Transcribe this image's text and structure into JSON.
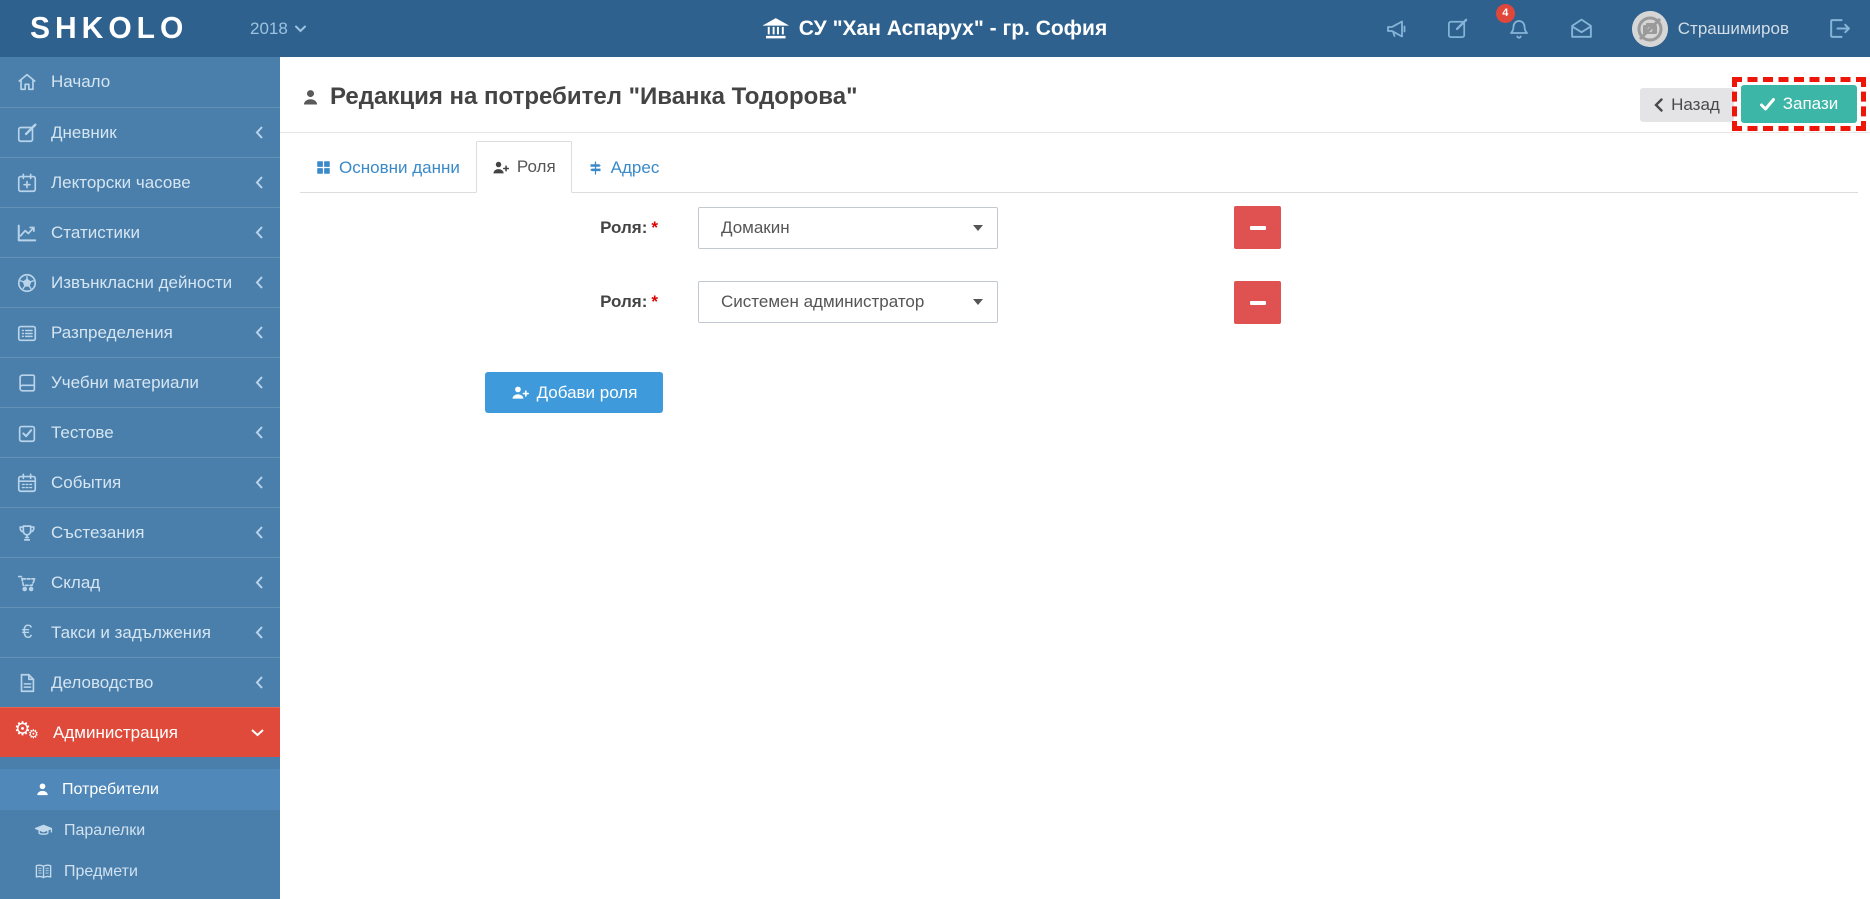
{
  "header": {
    "logo": "SHKOLO",
    "year": "2018",
    "school_name": "СУ \"Хан Аспарух\" - гр. София",
    "notifications_badge": "4",
    "username": "Страшимиров"
  },
  "sidebar": {
    "items": [
      {
        "label": "Начало",
        "icon": "home-icon",
        "expandable": false
      },
      {
        "label": "Дневник",
        "icon": "journal-icon",
        "expandable": true
      },
      {
        "label": "Лекторски часове",
        "icon": "calendar-plus-icon",
        "expandable": true
      },
      {
        "label": "Статистики",
        "icon": "line-chart-icon",
        "expandable": true
      },
      {
        "label": "Извънкласни дейности",
        "icon": "soccer-ball-icon",
        "expandable": true
      },
      {
        "label": "Разпределения",
        "icon": "list-icon",
        "expandable": true
      },
      {
        "label": "Учебни материали",
        "icon": "book-icon",
        "expandable": true
      },
      {
        "label": "Тестове",
        "icon": "check-square-icon",
        "expandable": true
      },
      {
        "label": "События",
        "icon": "calendar-icon",
        "expandable": true
      },
      {
        "label": "Състезания",
        "icon": "trophy-icon",
        "expandable": true
      },
      {
        "label": "Склад",
        "icon": "cart-icon",
        "expandable": true
      },
      {
        "label": "Такси и задължения",
        "icon": "euro-icon",
        "expandable": true
      },
      {
        "label": "Деловодство",
        "icon": "file-text-icon",
        "expandable": true
      },
      {
        "label": "Администрация",
        "icon": "gears-icon",
        "expandable": true,
        "active": true,
        "expanded": true
      }
    ],
    "submenu": [
      {
        "label": "Потребители",
        "icon": "user-icon",
        "active": true
      },
      {
        "label": "Паралелки",
        "icon": "graduation-cap-icon",
        "active": false
      },
      {
        "label": "Предмети",
        "icon": "open-book-icon",
        "active": false
      }
    ]
  },
  "page": {
    "title": "Редакция на потребител \"Иванка Тодорова\"",
    "back_label": "Назад",
    "save_label": "Запази"
  },
  "tabs": [
    {
      "label": "Основни данни",
      "icon": "grid-icon",
      "active": false
    },
    {
      "label": "Роля",
      "icon": "user-plus-icon",
      "active": true
    },
    {
      "label": "Адрес",
      "icon": "signpost-icon",
      "active": false
    }
  ],
  "form": {
    "label": "Роля:",
    "required_marker": "*",
    "roles": [
      {
        "value": "Домакин"
      },
      {
        "value": "Системен администратор"
      }
    ],
    "add_button": "Добави роля"
  },
  "colors": {
    "header_bg": "#2e618e",
    "sidebar_bg": "#4a7fab",
    "active_menu_red": "#df4a3a",
    "save_teal": "#3cb6a7",
    "add_blue": "#3e9adb",
    "remove_red": "#e05252",
    "annotation_red": "#ee1509",
    "tab_link_blue": "#3a89c8"
  }
}
